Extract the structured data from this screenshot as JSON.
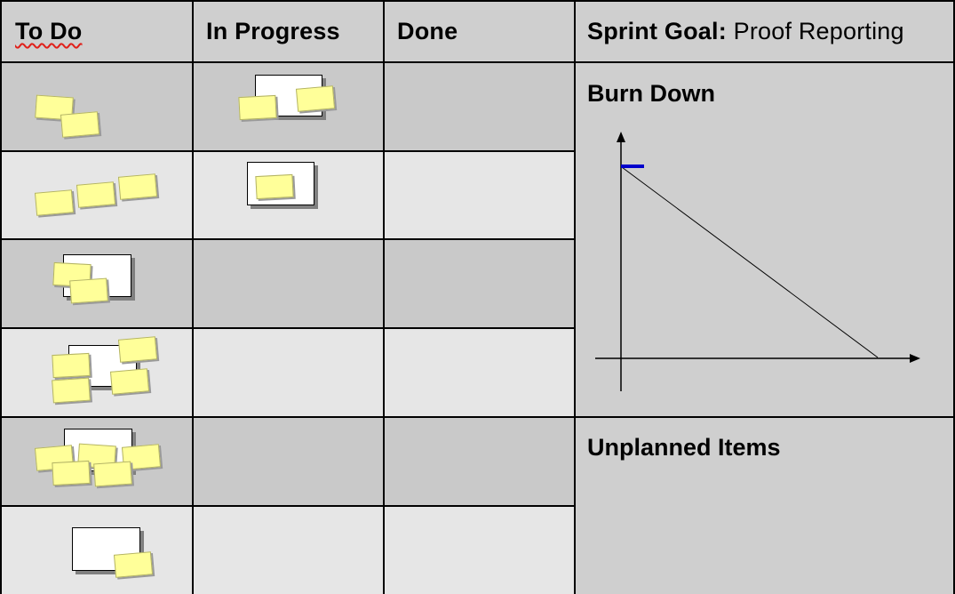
{
  "columns": {
    "todo": "To Do",
    "in_progress": "In Progress",
    "done": "Done"
  },
  "sprint_goal": {
    "label": "Sprint Goal:",
    "value": "Proof Reporting"
  },
  "burn_down": {
    "title": "Burn Down"
  },
  "unplanned": {
    "title": "Unplanned Items"
  },
  "colors": {
    "sticky_note": "#ffff99",
    "burn_marker": "#0000cc"
  }
}
